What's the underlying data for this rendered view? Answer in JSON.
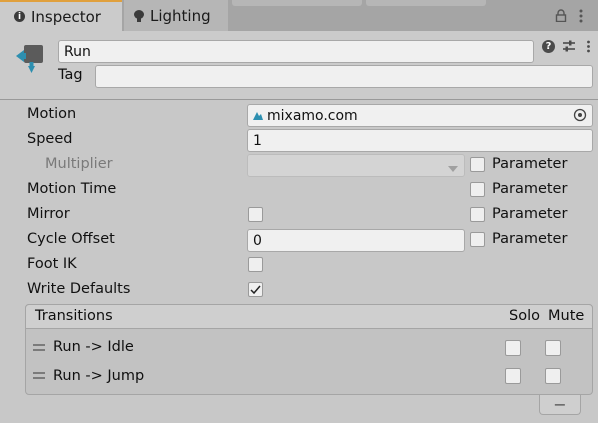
{
  "tabs": [
    {
      "label": "Inspector",
      "icon": "info-icon"
    },
    {
      "label": "Lighting",
      "icon": "lightbulb-icon"
    }
  ],
  "toolbar": {
    "lock_icon": "lock-icon",
    "menu_icon": "kebab-menu-icon"
  },
  "header": {
    "name_value": "Run",
    "tag_label": "Tag",
    "tag_value": ""
  },
  "fields": {
    "motion_label": "Motion",
    "motion_value": "mixamo.com",
    "speed_label": "Speed",
    "speed_value": "1",
    "multiplier_label": "Multiplier",
    "motion_time_label": "Motion Time",
    "mirror_label": "Mirror",
    "cycle_offset_label": "Cycle Offset",
    "cycle_offset_value": "0",
    "foot_ik_label": "Foot IK",
    "write_defaults_label": "Write Defaults",
    "write_defaults_checked": true,
    "parameter_label": "Parameter"
  },
  "transitions": {
    "title": "Transitions",
    "solo_label": "Solo",
    "mute_label": "Mute",
    "items": [
      {
        "label": "Run -> Idle"
      },
      {
        "label": "Run -> Jump"
      }
    ],
    "remove_label": "−"
  },
  "colors": {
    "accent_tab": "#e0a03d",
    "icon_teal": "#2d8fb0"
  }
}
